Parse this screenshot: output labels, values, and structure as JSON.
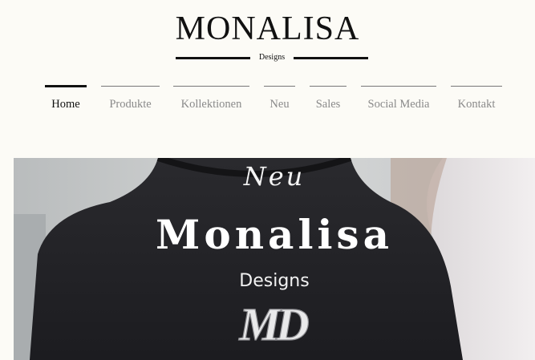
{
  "brand": {
    "title": "MONALISA",
    "subtitle": "Designs"
  },
  "nav": {
    "items": [
      {
        "label": "Home",
        "active": true
      },
      {
        "label": "Produkte",
        "active": false
      },
      {
        "label": "Kollektionen",
        "active": false
      },
      {
        "label": "Neu",
        "active": false
      },
      {
        "label": "Sales",
        "active": false
      },
      {
        "label": "Social Media",
        "active": false
      },
      {
        "label": "Kontakt",
        "active": false
      }
    ]
  },
  "hero": {
    "tag": "Neu",
    "title": "Monalisa",
    "subtitle": "Designs",
    "monogram": "MD"
  },
  "colors": {
    "page_bg": "#fcfbf6",
    "nav_active": "#111111",
    "nav_inactive": "#8a8a8a",
    "hero_text": "#ffffff"
  }
}
